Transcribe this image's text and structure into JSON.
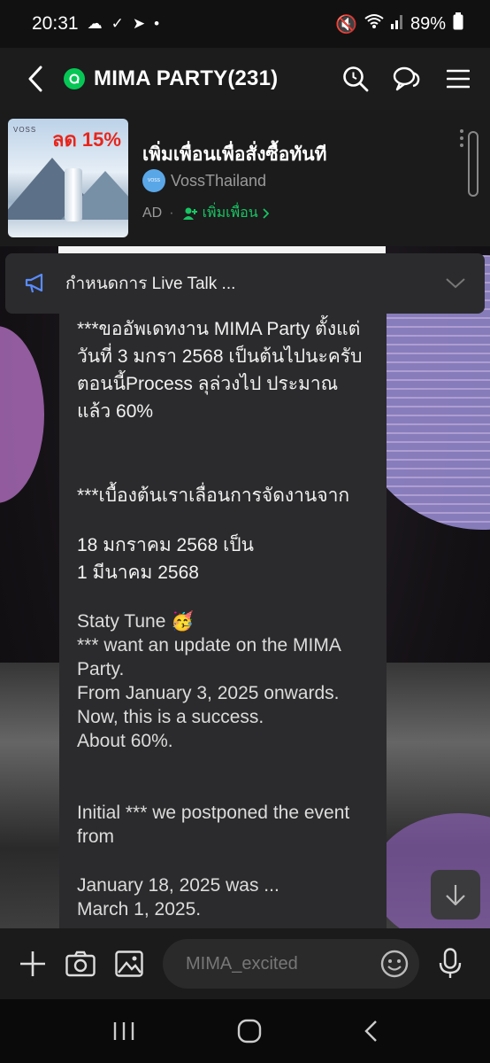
{
  "status_bar": {
    "time": "20:31",
    "battery": "89%"
  },
  "header": {
    "title": "MIMA PARTY(231)"
  },
  "ad": {
    "title": "เพิ่มเพื่อนเพื่อสั่งซื้อทันที",
    "account": "VossThailand",
    "ad_label": "AD",
    "separator": "·",
    "add_friend": "เพิ่มเพื่อน",
    "image_discount": "ลด 15%",
    "image_brand": "VOSS",
    "logo_text": "VOSS"
  },
  "announcement": {
    "text": "กำหนดการ Live Talk ..."
  },
  "message": {
    "th_1": "***ขออัพเดทงาน MIMA Party ตั้งแต่วันที่ 3 มกรา 2568 เป็นต้นไปนะครับ ตอนนี้Process ลุล่วงไป ประมาณแล้ว 60%",
    "th_2": "***เบื้องต้นเราเลื่อนการจัดงานจาก",
    "th_3": "18 มกราคม 2568 เป็น",
    "th_4": "1 มีนาคม 2568",
    "en_0": "Staty Tune 🥳",
    "en_1": "*** want an update on the MIMA Party.",
    "en_2": "From January 3, 2025 onwards.",
    "en_3": "Now, this is a success.",
    "en_4": "About 60%.",
    "en_5": "Initial *** we postponed the event from",
    "en_6": "January 18, 2025 was ...",
    "en_7": "March 1, 2025."
  },
  "input": {
    "placeholder": "MIMA_excited"
  },
  "colors": {
    "accent_green": "#06c755",
    "bubble": "#2b2b2d",
    "header": "#1c1c1c"
  }
}
